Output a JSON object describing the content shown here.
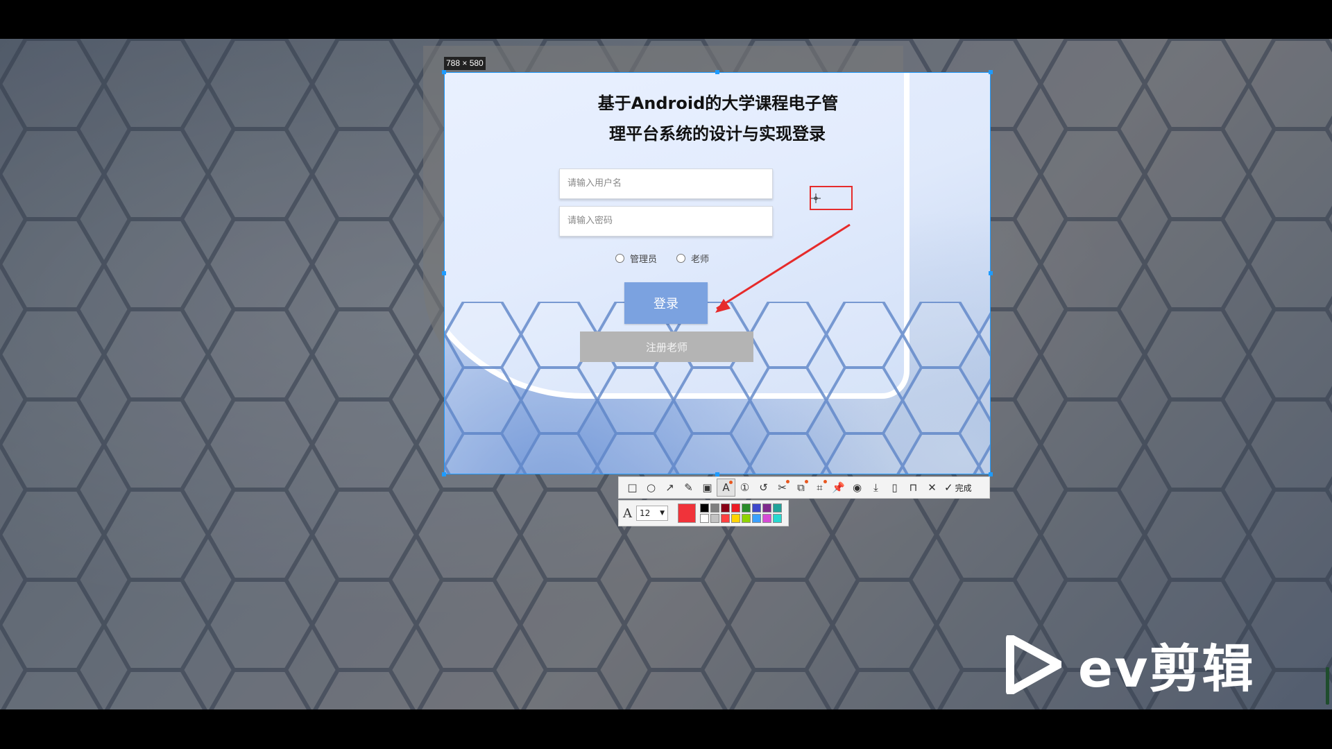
{
  "capture": {
    "size_label": "788 × 580"
  },
  "login": {
    "title_line1": "基于Android的大学课程电子管",
    "title_line2": "理平台系统的设计与实现登录",
    "username_placeholder": "请输入用户名",
    "password_placeholder": "请输入密码",
    "role_admin": "管理员",
    "role_teacher": "老师",
    "login_button": "登录",
    "register_button": "注册老师"
  },
  "toolbar": {
    "tools": [
      "rectangle-icon",
      "ellipse-icon",
      "arrow-icon",
      "pen-icon",
      "mosaic-icon",
      "text-icon",
      "number-icon",
      "undo-icon",
      "scissors-icon",
      "ocr-icon",
      "crop-icon",
      "pin-icon",
      "record-icon",
      "download-icon",
      "save-icon",
      "bookmark-icon",
      "close-icon"
    ],
    "done_label": "完成"
  },
  "text_options": {
    "font_size": "12",
    "current_color": "#f0333a",
    "palette": [
      "#000000",
      "#7f7f7f",
      "#880015",
      "#ed1c24",
      "#2a8c2a",
      "#3f48cc",
      "#7f2a8c",
      "#22a39a",
      "#ffffff",
      "#c3c3c3",
      "#ff4040",
      "#ffd400",
      "#8fd400",
      "#3ba0ff",
      "#d64bd6",
      "#27d9d0"
    ]
  },
  "watermark": {
    "brand_text": "ev剪辑"
  }
}
